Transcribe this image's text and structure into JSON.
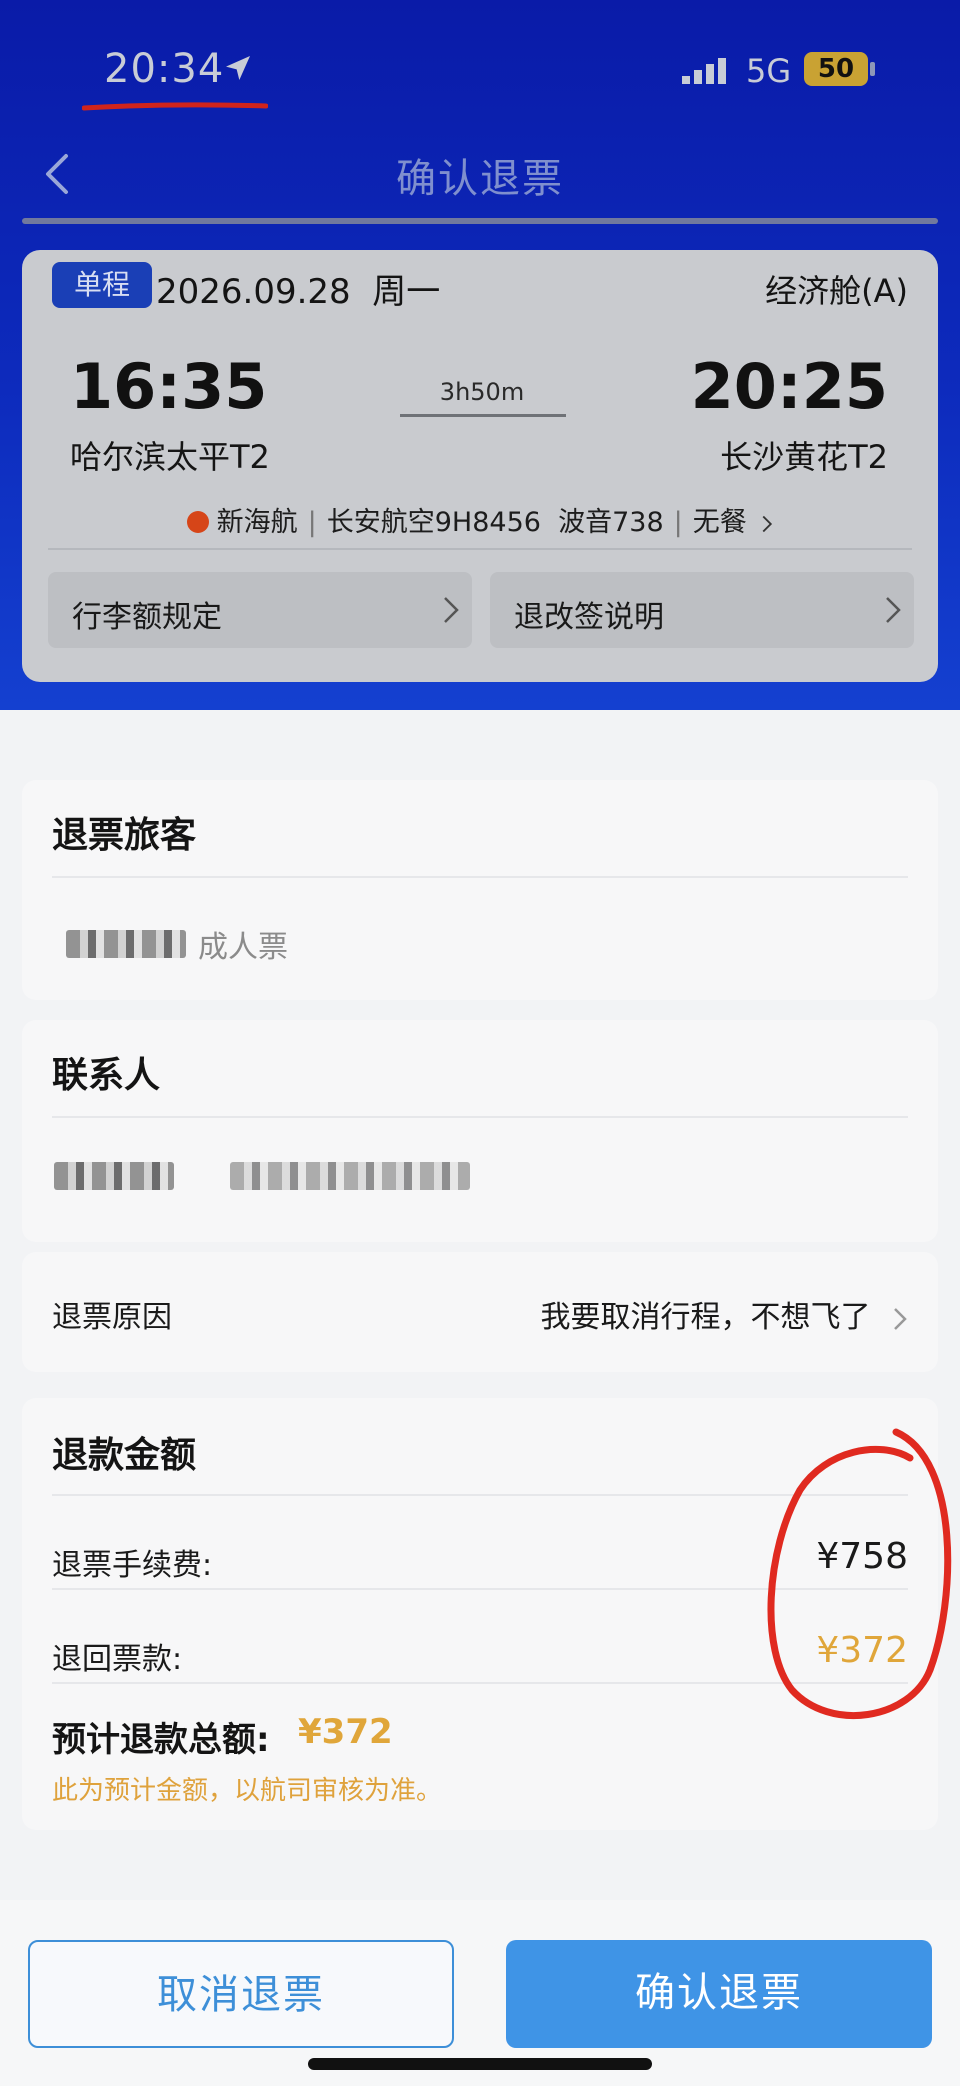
{
  "status_bar": {
    "time": "20:34",
    "network": "5G",
    "battery": "50"
  },
  "nav": {
    "title": "确认退票"
  },
  "flight": {
    "trip_type": "单程",
    "date": "2026.09.28",
    "weekday": "周一",
    "cabin": "经济舱(A)",
    "departure_time": "16:35",
    "arrival_time": "20:25",
    "duration": "3h50m",
    "departure_airport": "哈尔滨太平T2",
    "arrival_airport": "长沙黄花T2",
    "operator": "新海航",
    "carrier_flight": "长安航空9H8456",
    "aircraft": "波音738",
    "meal": "无餐",
    "baggage_label": "行李额规定",
    "refund_rules_label": "退改签说明"
  },
  "passenger": {
    "title": "退票旅客",
    "ticket_type": "成人票"
  },
  "contact": {
    "title": "联系人"
  },
  "reason": {
    "label": "退票原因",
    "value": "我要取消行程，不想飞了"
  },
  "refund": {
    "title": "退款金额",
    "fee_label": "退票手续费:",
    "fee_value": "¥758",
    "return_label": "退回票款:",
    "return_value": "¥372",
    "total_label": "预计退款总额:",
    "total_value": "¥372",
    "note": "此为预计金额，以航司审核为准。"
  },
  "actions": {
    "cancel": "取消退票",
    "confirm": "确认退票"
  },
  "colors": {
    "header_blue": "#0d2bbd",
    "accent_orange": "#e0a63a",
    "button_blue": "#3f94e6",
    "annotation_red": "#e02a20"
  }
}
